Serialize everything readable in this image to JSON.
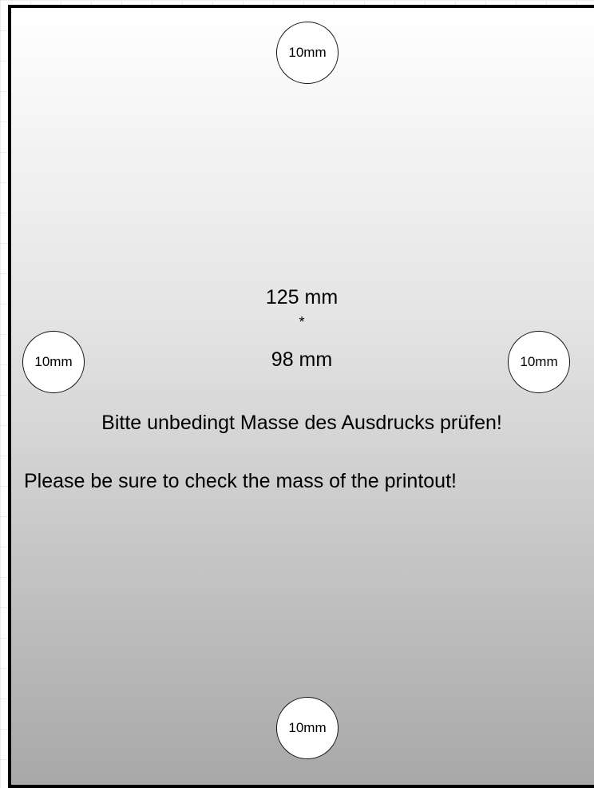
{
  "circles": {
    "top": "10mm",
    "left": "10mm",
    "right": "10mm",
    "bottom": "10mm"
  },
  "dimensions": {
    "width": "125 mm",
    "separator": "*",
    "height": "98 mm"
  },
  "notices": {
    "german": "Bitte unbedingt Masse des Ausdrucks prüfen!",
    "english": "Please be sure to check the mass of the printout!"
  },
  "colors": {
    "border": "#000000",
    "gradient_top": "#ffffff",
    "gradient_bottom": "#a8a8a8",
    "circle_fill": "#ffffff"
  }
}
